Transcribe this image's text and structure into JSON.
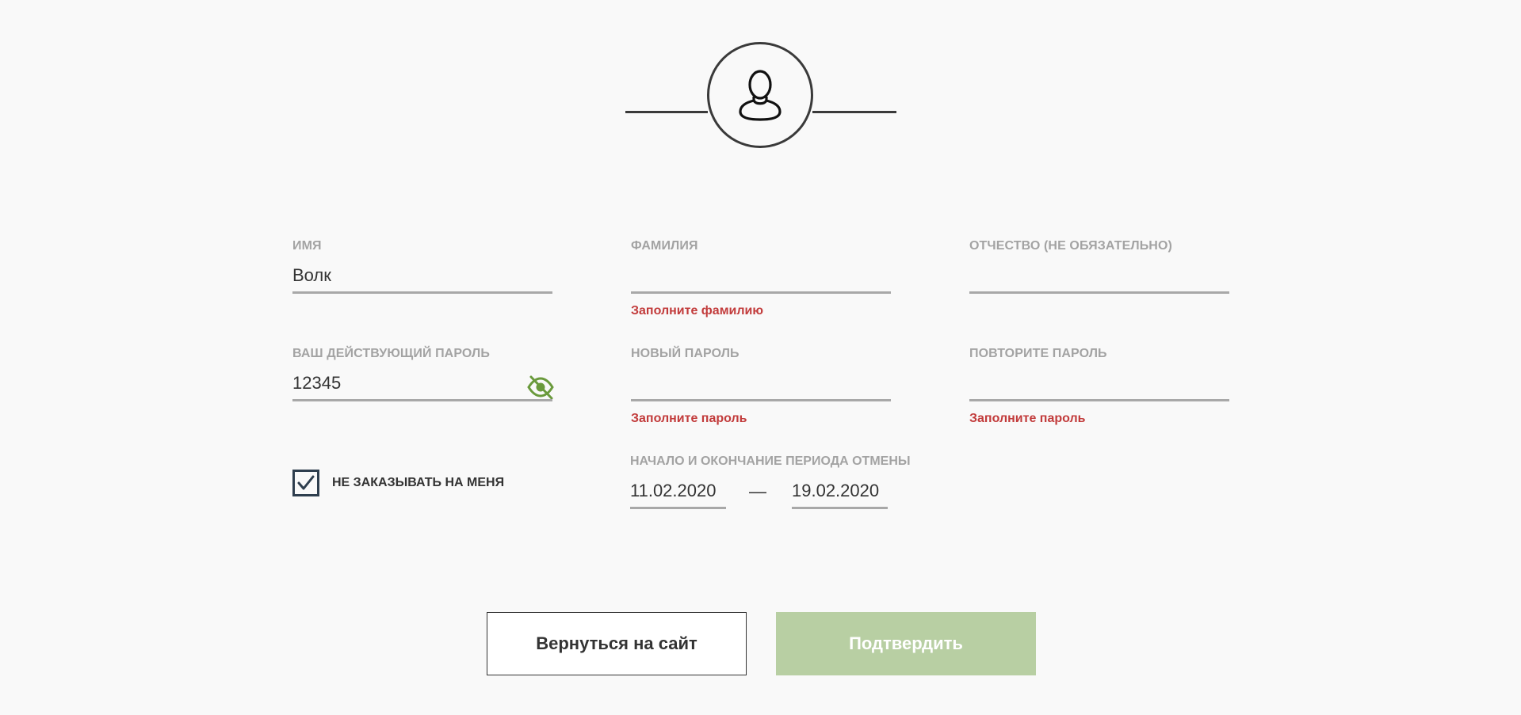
{
  "header": {
    "avatar_icon": "user-icon"
  },
  "form": {
    "first_name": {
      "label": "ИМЯ",
      "value": "Волк",
      "error": ""
    },
    "last_name": {
      "label": "ФАМИЛИЯ",
      "value": "",
      "error": "Заполните фамилию"
    },
    "middle_name": {
      "label": "ОТЧЕСТВО (НЕ ОБЯЗАТЕЛЬНО)",
      "value": "",
      "error": ""
    },
    "current_password": {
      "label": "ВАШ ДЕЙСТВУЮЩИЙ ПАРОЛЬ",
      "value": "12345",
      "error": "",
      "toggle_icon": "eye-off-icon"
    },
    "new_password": {
      "label": "НОВЫЙ ПАРОЛЬ",
      "value": "",
      "error": "Заполните пароль"
    },
    "repeat_password": {
      "label": "ПОВТОРИТЕ ПАРОЛЬ",
      "value": "",
      "error": "Заполните пароль"
    },
    "no_order_checkbox": {
      "label": "НЕ ЗАКАЗЫВАТЬ НА МЕНЯ",
      "checked": true
    },
    "period": {
      "label": "НАЧАЛО И ОКОНЧАНИЕ ПЕРИОДА ОТМЕНЫ",
      "start": "11.02.2020",
      "separator": "—",
      "end": "19.02.2020"
    }
  },
  "actions": {
    "back_label": "Вернуться на сайт",
    "confirm_label": "Подтвердить"
  },
  "colors": {
    "error": "#c23b3b",
    "accent_green": "#6a9a3c",
    "confirm_disabled": "#b8cfa3",
    "checkbox_border": "#2e3e4e"
  }
}
